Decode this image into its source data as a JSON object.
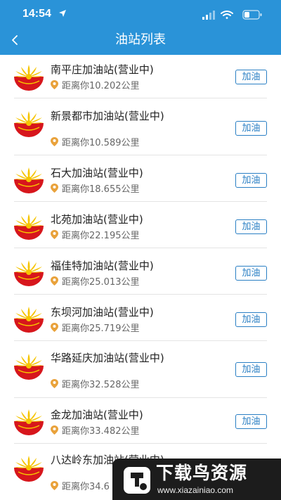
{
  "status_bar": {
    "time": "14:54"
  },
  "header": {
    "title": "油站列表"
  },
  "stations": [
    {
      "name": "南平庄加油站(营业中)",
      "distance": "距离你10.202公里",
      "action": "加油"
    },
    {
      "name": "新景都市加油站(营业中)",
      "distance": "距离你10.589公里",
      "action": "加油"
    },
    {
      "name": "石大加油站(营业中)",
      "distance": "距离你18.655公里",
      "action": "加油"
    },
    {
      "name": "北苑加油站(营业中)",
      "distance": "距离你22.195公里",
      "action": "加油"
    },
    {
      "name": "福佳特加油站(营业中)",
      "distance": "距离你25.013公里",
      "action": "加油"
    },
    {
      "name": "东坝河加油站(营业中)",
      "distance": "距离你25.719公里",
      "action": "加油"
    },
    {
      "name": "华路延庆加油站(营业中)",
      "distance": "距离你32.528公里",
      "action": "加油"
    },
    {
      "name": "金龙加油站(营业中)",
      "distance": "距离你33.482公里",
      "action": "加油"
    },
    {
      "name": "八达岭东加油站(营业中)",
      "distance": "距离你34.6",
      "action": ""
    }
  ],
  "watermark": {
    "title": "下载鸟资源",
    "url": "www.xiazainiao.com"
  },
  "colors": {
    "header": "#2a93d8",
    "accent": "#2a7fc4",
    "logo_red": "#d7161c",
    "logo_yellow": "#f6c400"
  }
}
